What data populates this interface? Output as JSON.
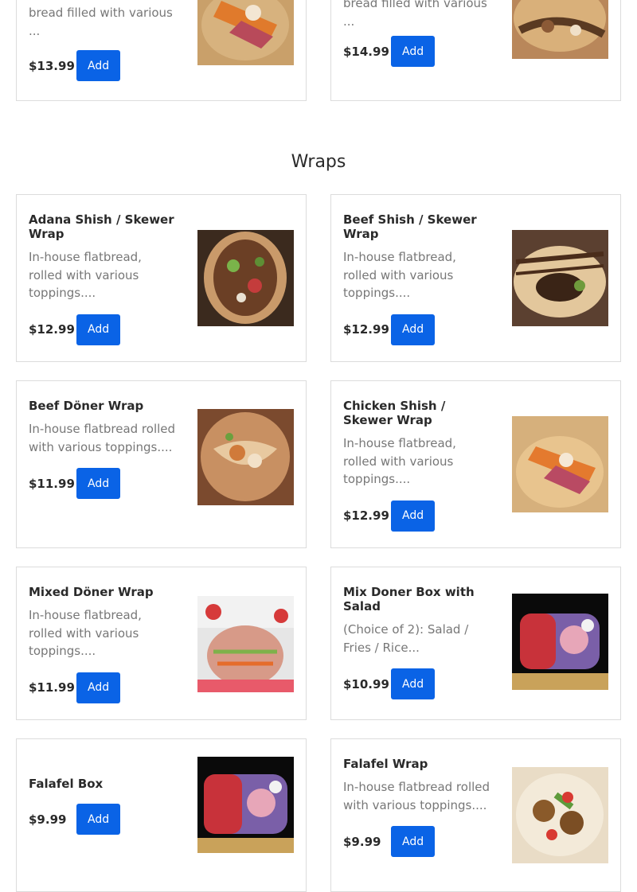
{
  "top_cards": [
    {
      "desc_partial": "bread filled with various",
      "desc_end": "...",
      "price": "$13.99",
      "add_label": "Add"
    },
    {
      "desc_partial": "bread filled with various",
      "desc_end": "...",
      "price": "$14.99",
      "add_label": "Add"
    }
  ],
  "section": {
    "title": "Wraps"
  },
  "items": [
    {
      "name": "Adana Shish / Skewer Wrap",
      "desc": "In-house flatbread, rolled with various toppings....",
      "price": "$12.99",
      "add_label": "Add",
      "image": "wrap-photo"
    },
    {
      "name": "Beef Shish / Skewer Wrap",
      "desc": "In-house flatbread, rolled with various toppings....",
      "price": "$12.99",
      "add_label": "Add",
      "image": "wrap-photo"
    },
    {
      "name": "Beef Döner Wrap",
      "desc": "In-house flatbread rolled with various toppings....",
      "price": "$11.99",
      "add_label": "Add",
      "image": "wrap-photo"
    },
    {
      "name": "Chicken Shish / Skewer Wrap",
      "desc": "In-house flatbread, rolled with various toppings....",
      "price": "$12.99",
      "add_label": "Add",
      "image": "wrap-photo"
    },
    {
      "name": "Mixed Döner Wrap",
      "desc": "In-house flatbread, rolled with various toppings....",
      "price": "$11.99",
      "add_label": "Add",
      "image": "wrap-photo"
    },
    {
      "name": "Mix Doner Box with Salad",
      "desc": "(Choice of 2): Salad / Fries / Rice...",
      "price": "$10.99",
      "add_label": "Add",
      "image": "box-photo"
    },
    {
      "name": "Falafel Box",
      "desc": "",
      "price": "$9.99",
      "add_label": "Add",
      "image": "box-photo"
    },
    {
      "name": "Falafel Wrap",
      "desc": "In-house flatbread rolled with various toppings....",
      "price": "$9.99",
      "add_label": "Add",
      "image": "wrap-photo"
    }
  ],
  "colors": {
    "accent": "#0a63e6",
    "border": "#dcdcdc",
    "muted_text": "#777777"
  }
}
